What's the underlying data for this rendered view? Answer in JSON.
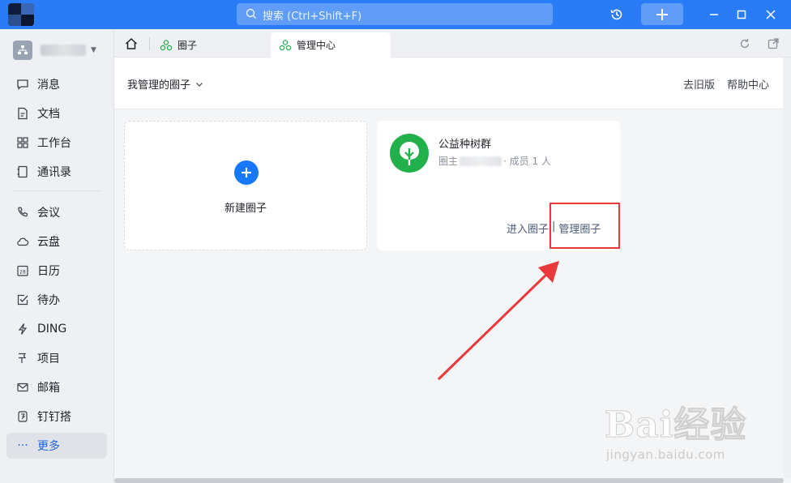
{
  "titlebar": {
    "search_placeholder": "搜索 (Ctrl+Shift+F)",
    "accent": "#2a7cf6"
  },
  "sidebar": {
    "items": [
      {
        "label": "消息",
        "icon": "message-icon"
      },
      {
        "label": "文档",
        "icon": "document-icon"
      },
      {
        "label": "工作台",
        "icon": "workbench-icon"
      },
      {
        "label": "通讯录",
        "icon": "contacts-icon"
      },
      {
        "label": "会议",
        "icon": "meeting-icon"
      },
      {
        "label": "云盘",
        "icon": "cloud-icon"
      },
      {
        "label": "日历",
        "icon": "calendar-icon"
      },
      {
        "label": "待办",
        "icon": "todo-icon"
      },
      {
        "label": "DING",
        "icon": "ding-icon"
      },
      {
        "label": "项目",
        "icon": "project-icon"
      },
      {
        "label": "邮箱",
        "icon": "mail-icon"
      },
      {
        "label": "钉钉搭",
        "icon": "dingtalk-builder-icon"
      },
      {
        "label": "更多",
        "icon": "more-icon",
        "active": true
      }
    ]
  },
  "tabs": [
    {
      "label": "圈子"
    },
    {
      "label": "管理中心",
      "active": true
    }
  ],
  "header": {
    "my_circles": "我管理的圈子",
    "old_version": "去旧版",
    "help_center": "帮助中心"
  },
  "new_circle": {
    "label": "新建圈子"
  },
  "circle": {
    "name": "公益种树群",
    "owner_prefix": "圈主",
    "members": "· 成员 1 人",
    "enter": "进入圈子",
    "separator": "|",
    "manage": "管理圈子"
  },
  "watermark": {
    "main": "Bai经验",
    "sub": "jingyan.baidu.com"
  }
}
